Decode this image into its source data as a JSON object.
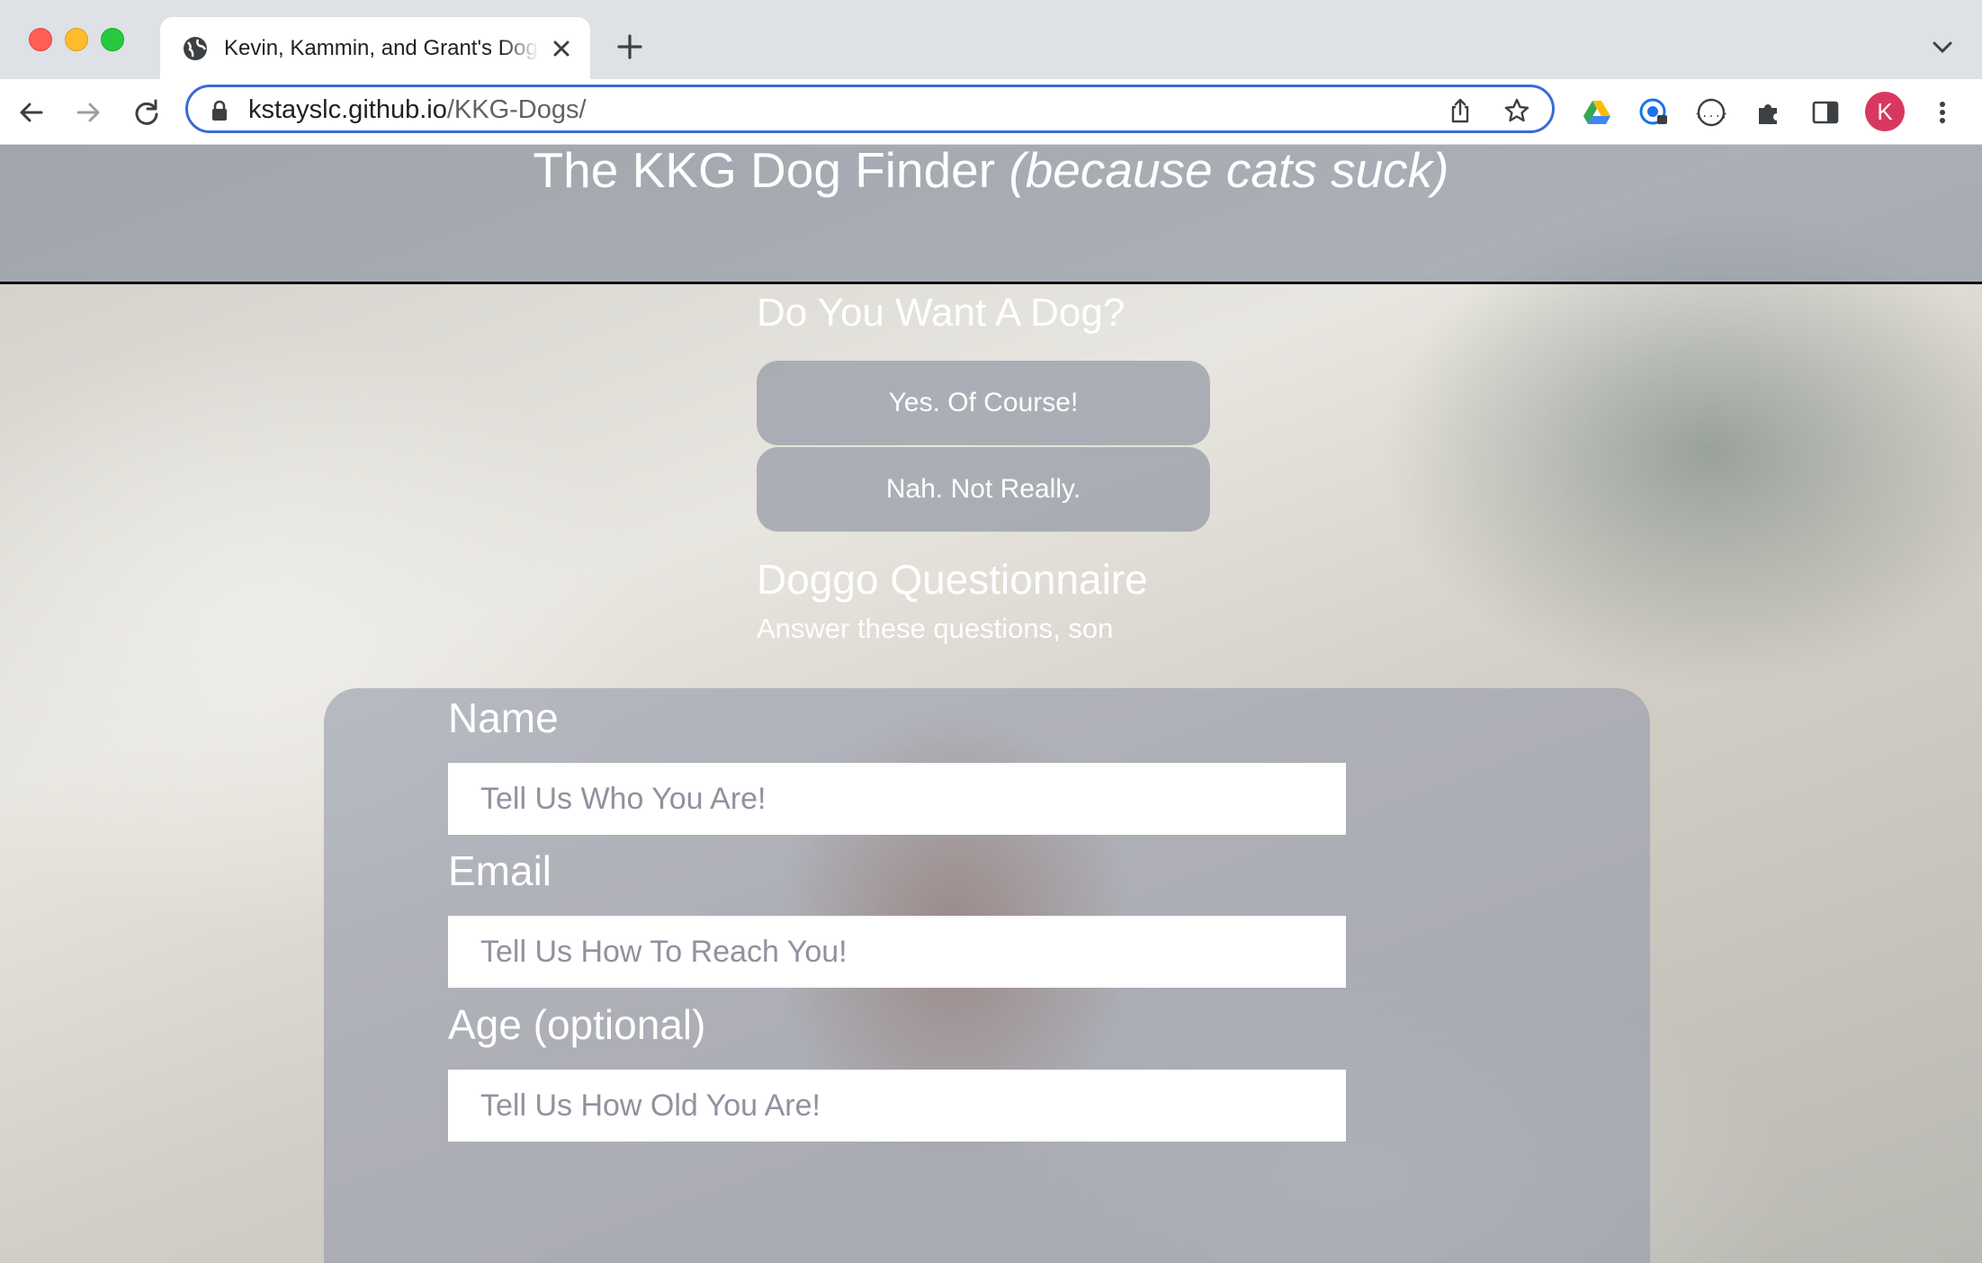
{
  "browser": {
    "tab": {
      "title": "Kevin, Kammin, and Grant's Dog Finder"
    },
    "address_bar": {
      "host": "kstayslc.github.io",
      "path": "/KKG-Dogs/"
    },
    "profile_initial": "K"
  },
  "page": {
    "title_main": "The KKG Dog Finder ",
    "title_italic": "(because cats suck)",
    "question": {
      "heading": "Do You Want A Dog?",
      "yes_label": "Yes. Of Course!",
      "no_label": "Nah. Not Really."
    },
    "questionnaire": {
      "title": "Doggo Questionnaire",
      "subtitle": "Answer these questions, son",
      "fields": [
        {
          "label": "Name",
          "placeholder": "Tell Us Who You Are!"
        },
        {
          "label": "Email",
          "placeholder": "Tell Us How To Reach You!"
        },
        {
          "label": "Age (optional)",
          "placeholder": "Tell Us How Old You Are!"
        }
      ]
    }
  },
  "colors": {
    "accent_focus_ring": "#3b6bd0",
    "profile_avatar": "#d9385e"
  }
}
